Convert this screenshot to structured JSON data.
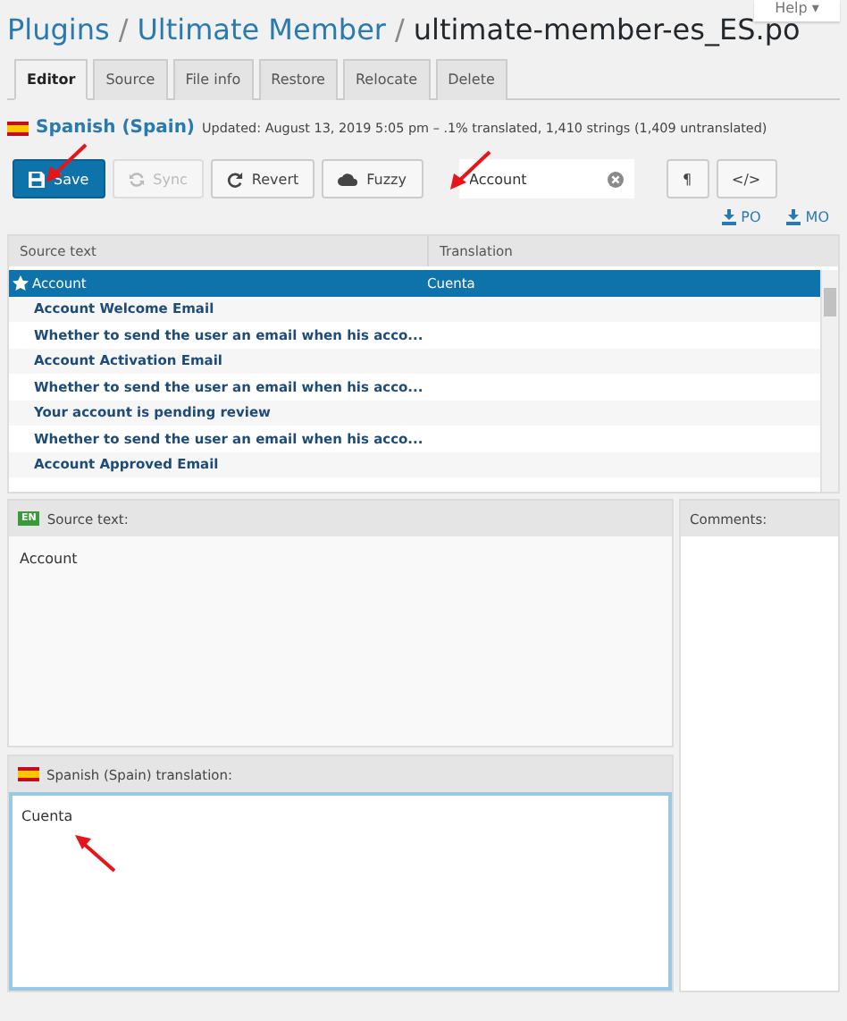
{
  "help": {
    "label": "Help",
    "caret": "▾"
  },
  "breadcrumb": [
    "Plugins",
    "Ultimate Member"
  ],
  "breadcrumb_separators": [
    "/",
    "/"
  ],
  "file_name": "ultimate-member-es_ES.po",
  "tabs": [
    {
      "label": "Editor",
      "selected": true
    },
    {
      "label": "Source",
      "selected": false
    },
    {
      "label": "File info",
      "selected": false
    },
    {
      "label": "Restore",
      "selected": false
    },
    {
      "label": "Relocate",
      "selected": false
    },
    {
      "label": "Delete",
      "selected": false
    }
  ],
  "locale": {
    "name": "Spanish (Spain)",
    "status": "Updated: August 13, 2019 5:05 pm – .1% translated, 1,410 strings (1,409 untranslated)"
  },
  "toolbar": [
    {
      "kind": "save",
      "label": "Save",
      "disabled": false
    },
    {
      "kind": "sync",
      "label": "Sync",
      "disabled": true
    },
    {
      "kind": "revert",
      "label": "Revert",
      "disabled": false
    },
    {
      "kind": "fuzzy",
      "label": "Fuzzy",
      "disabled": false
    }
  ],
  "filter": {
    "value": "Account"
  },
  "format_buttons": [
    "¶",
    "</>"
  ],
  "downloads": [
    "PO",
    "MO"
  ],
  "table": {
    "columns": [
      "Source text",
      "Translation"
    ],
    "rows": [
      {
        "source": "Account",
        "translation": "Cuenta",
        "selected": true
      },
      {
        "source": "Account Welcome Email",
        "selected": false
      },
      {
        "source": "Whether to send the user an email when his acco...",
        "selected": false
      },
      {
        "source": "Account Activation Email",
        "selected": false
      },
      {
        "source": "Whether to send the user an email when his acco...",
        "selected": false
      },
      {
        "source": "Your account is pending review",
        "selected": false
      },
      {
        "source": "Whether to send the user an email when his acco...",
        "selected": false
      },
      {
        "source": "Account Approved Email",
        "selected": false
      }
    ]
  },
  "source_panel": {
    "lang_badge": "EN",
    "title": "Source text:",
    "text": "Account"
  },
  "comments_panel": {
    "title": "Comments:"
  },
  "translation_panel": {
    "title": "Spanish (Spain) translation:",
    "value": "Cuenta"
  }
}
